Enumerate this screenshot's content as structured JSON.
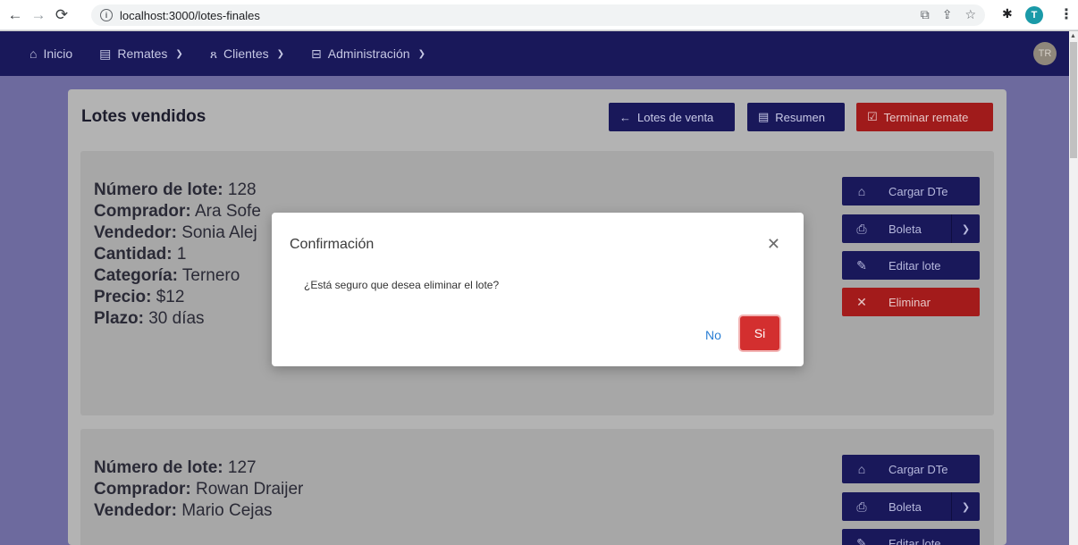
{
  "browser": {
    "url": "localhost:3000/lotes-finales",
    "profile_initial": "T"
  },
  "navbar": {
    "items": [
      {
        "label": "Inicio",
        "icon": "home-icon",
        "has_dropdown": false
      },
      {
        "label": "Remates",
        "icon": "document-icon",
        "has_dropdown": true
      },
      {
        "label": "Clientes",
        "icon": "users-icon",
        "has_dropdown": true
      },
      {
        "label": "Administración",
        "icon": "briefcase-icon",
        "has_dropdown": true
      }
    ],
    "avatar_initials": "TR"
  },
  "page": {
    "title": "Lotes vendidos",
    "buttons": {
      "lotes_venta": "Lotes de venta",
      "resumen": "Resumen",
      "terminar": "Terminar remate"
    }
  },
  "lotes": [
    {
      "numero_label": "Número de lote:",
      "numero": "128",
      "comprador_label": "Comprador:",
      "comprador": "Ara Sofe",
      "vendedor_label": "Vendedor:",
      "vendedor": "Sonia Alej",
      "cantidad_label": "Cantidad:",
      "cantidad": "1",
      "categoria_label": "Categoría:",
      "categoria": "Ternero",
      "precio_label": "Precio:",
      "precio": "$12",
      "plazo_label": "Plazo:",
      "plazo": "30 días"
    },
    {
      "numero_label": "Número de lote:",
      "numero": "127",
      "comprador_label": "Comprador:",
      "comprador": "Rowan Draijer",
      "vendedor_label": "Vendedor:",
      "vendedor": "Mario Cejas"
    }
  ],
  "lote_actions": {
    "cargar_dte": "Cargar DTe",
    "boleta": "Boleta",
    "editar": "Editar lote",
    "eliminar": "Eliminar"
  },
  "modal": {
    "title": "Confirmación",
    "message": "¿Está seguro que desea eliminar el lote?",
    "no_label": "No",
    "si_label": "Si"
  },
  "colors": {
    "navbar": "#19185a",
    "danger": "#d32f2f",
    "link": "#2a7fd4"
  }
}
